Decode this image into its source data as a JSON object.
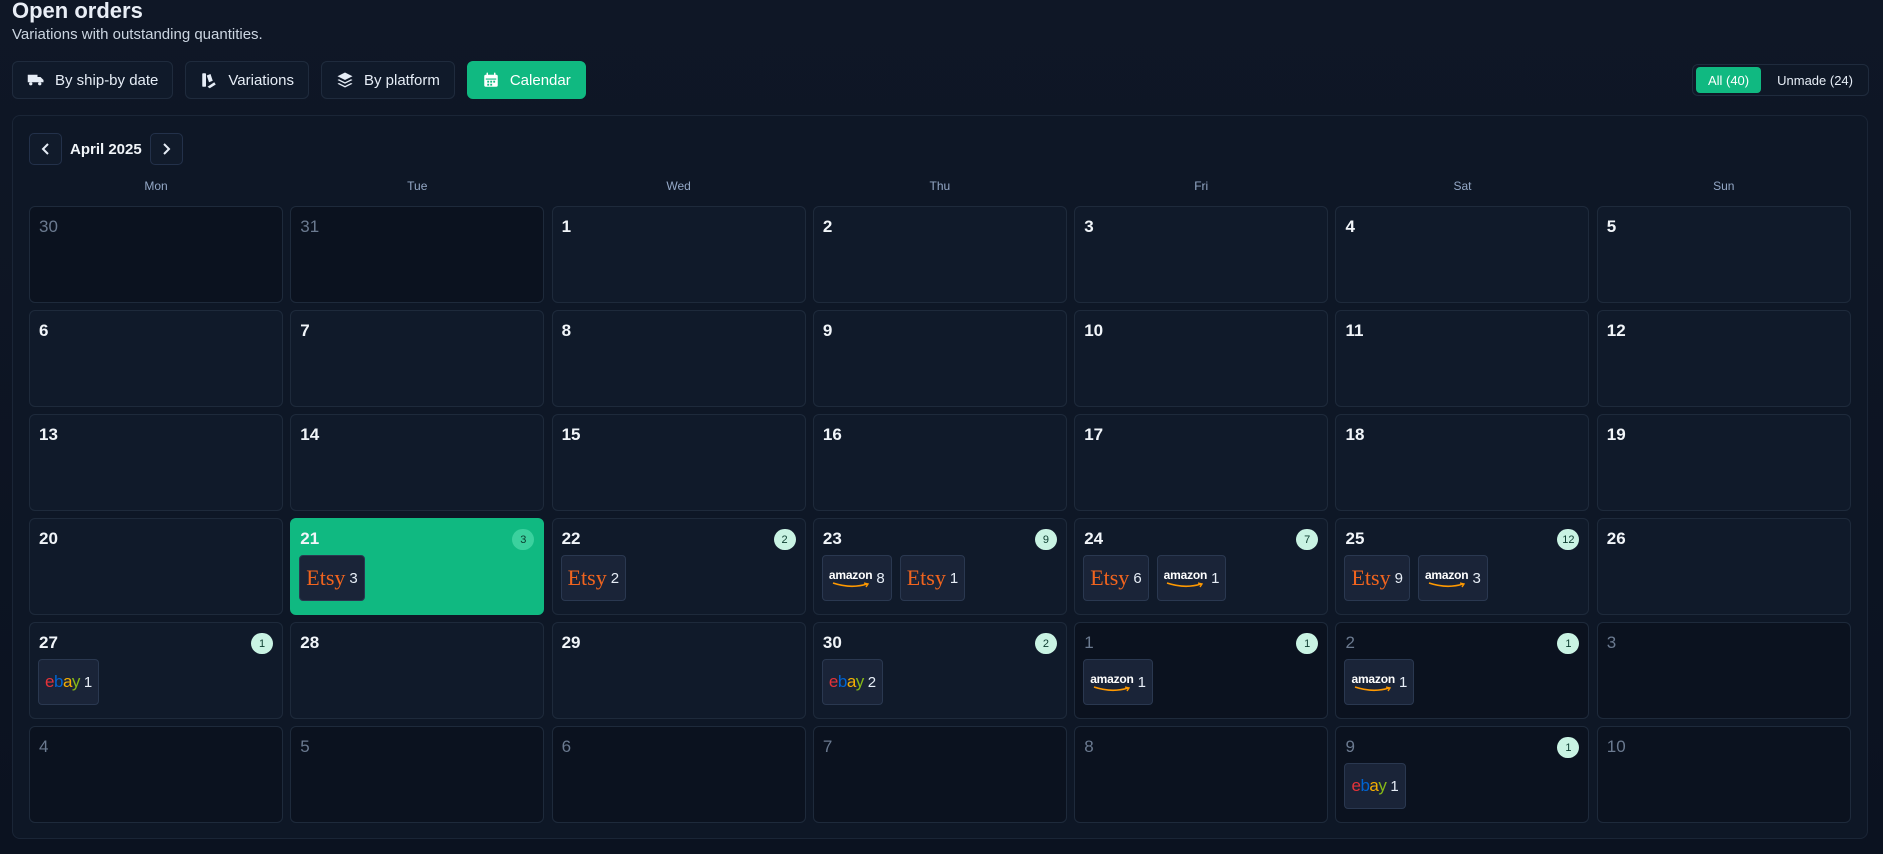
{
  "header": {
    "title": "Open orders",
    "subtitle": "Variations with outstanding quantities."
  },
  "tabs": [
    {
      "label": "By ship-by date",
      "icon": "truck-icon",
      "active": false
    },
    {
      "label": "Variations",
      "icon": "variations-icon",
      "active": false
    },
    {
      "label": "By platform",
      "icon": "layers-icon",
      "active": false
    },
    {
      "label": "Calendar",
      "icon": "calendar-icon",
      "active": true
    }
  ],
  "filters": [
    {
      "label": "All (40)",
      "active": true
    },
    {
      "label": "Unmade (24)",
      "active": false
    }
  ],
  "calendar": {
    "month_label": "April 2025",
    "weekdays": [
      "Mon",
      "Tue",
      "Wed",
      "Thu",
      "Fri",
      "Sat",
      "Sun"
    ],
    "cells": [
      {
        "day": "30",
        "out": true
      },
      {
        "day": "31",
        "out": true
      },
      {
        "day": "1"
      },
      {
        "day": "2"
      },
      {
        "day": "3"
      },
      {
        "day": "4"
      },
      {
        "day": "5"
      },
      {
        "day": "6"
      },
      {
        "day": "7"
      },
      {
        "day": "8"
      },
      {
        "day": "9"
      },
      {
        "day": "10"
      },
      {
        "day": "11"
      },
      {
        "day": "12"
      },
      {
        "day": "13"
      },
      {
        "day": "14"
      },
      {
        "day": "15"
      },
      {
        "day": "16"
      },
      {
        "day": "17"
      },
      {
        "day": "18"
      },
      {
        "day": "19"
      },
      {
        "day": "20"
      },
      {
        "day": "21",
        "today": true,
        "count": "3",
        "chips": [
          {
            "platform": "etsy",
            "label": "Etsy",
            "qty": "3"
          }
        ]
      },
      {
        "day": "22",
        "count": "2",
        "chips": [
          {
            "platform": "etsy",
            "label": "Etsy",
            "qty": "2"
          }
        ]
      },
      {
        "day": "23",
        "count": "9",
        "chips": [
          {
            "platform": "amazon",
            "label": "amazon",
            "qty": "8"
          },
          {
            "platform": "etsy",
            "label": "Etsy",
            "qty": "1"
          }
        ]
      },
      {
        "day": "24",
        "count": "7",
        "chips": [
          {
            "platform": "etsy",
            "label": "Etsy",
            "qty": "6"
          },
          {
            "platform": "amazon",
            "label": "amazon",
            "qty": "1"
          }
        ]
      },
      {
        "day": "25",
        "count": "12",
        "chips": [
          {
            "platform": "etsy",
            "label": "Etsy",
            "qty": "9"
          },
          {
            "platform": "amazon",
            "label": "amazon",
            "qty": "3"
          }
        ]
      },
      {
        "day": "26"
      },
      {
        "day": "27",
        "count": "1",
        "chips": [
          {
            "platform": "ebay",
            "label": "ebay",
            "qty": "1"
          }
        ]
      },
      {
        "day": "28"
      },
      {
        "day": "29"
      },
      {
        "day": "30",
        "count": "2",
        "chips": [
          {
            "platform": "ebay",
            "label": "ebay",
            "qty": "2"
          }
        ]
      },
      {
        "day": "1",
        "out": true,
        "count": "1",
        "chips": [
          {
            "platform": "amazon",
            "label": "amazon",
            "qty": "1"
          }
        ]
      },
      {
        "day": "2",
        "out": true,
        "count": "1",
        "chips": [
          {
            "platform": "amazon",
            "label": "amazon",
            "qty": "1"
          }
        ]
      },
      {
        "day": "3",
        "out": true
      },
      {
        "day": "4",
        "out": true
      },
      {
        "day": "5",
        "out": true
      },
      {
        "day": "6",
        "out": true
      },
      {
        "day": "7",
        "out": true
      },
      {
        "day": "8",
        "out": true
      },
      {
        "day": "9",
        "out": true,
        "count": "1",
        "chips": [
          {
            "platform": "ebay",
            "label": "ebay",
            "qty": "1"
          }
        ]
      },
      {
        "day": "10",
        "out": true
      }
    ]
  },
  "colors": {
    "accent": "#10b981",
    "etsy": "#f1641e",
    "ebay_e": "#e53238",
    "ebay_b": "#0064d2",
    "ebay_a": "#f5af02",
    "ebay_y": "#86b817"
  }
}
